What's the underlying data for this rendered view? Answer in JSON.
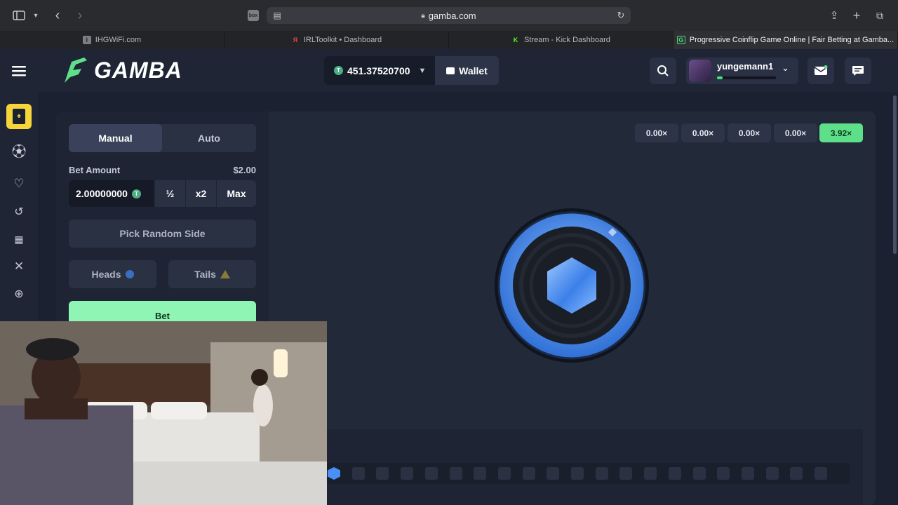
{
  "browser": {
    "url": "gamba.com",
    "tabs": [
      {
        "title": "IHGWiFi.com",
        "favicon": "I",
        "favicon_color": "#7d7e83"
      },
      {
        "title": "IRLToolkit • Dashboard",
        "favicon": "Я",
        "favicon_color": "#e0453a"
      },
      {
        "title": "Stream - Kick Dashboard",
        "favicon": "K",
        "favicon_color": "#53fc18"
      },
      {
        "title": "Progressive Coinflip Game Online | Fair Betting at Gamba...",
        "favicon": "G",
        "favicon_color": "#4ade80",
        "active": true
      }
    ]
  },
  "header": {
    "logo_text": "GAMBA",
    "balance": "451.37520700",
    "balance_token": "T",
    "wallet_label": "Wallet",
    "username": "yungemann1",
    "xp_fraction": 0.1
  },
  "controls": {
    "tab_manual": "Manual",
    "tab_auto": "Auto",
    "bet_amount_label": "Bet Amount",
    "bet_amount_usd": "$2.00",
    "bet_value": "2.00000000",
    "half_label": "½",
    "double_label": "x2",
    "max_label": "Max",
    "random_side_label": "Pick Random Side",
    "heads_label": "Heads",
    "tails_label": "Tails",
    "bet_label": "Bet"
  },
  "multipliers": [
    "0.00×",
    "0.00×",
    "0.00×",
    "0.00×",
    "3.92×"
  ],
  "colors": {
    "accent_green": "#5ee08a",
    "bet_green": "#8ff5b5",
    "coin_blue": "#4a8ff5",
    "tails_gold": "#8a7a3a"
  },
  "history": {
    "squares": 21,
    "active_index": 0
  },
  "rail_icons": [
    "cards-icon",
    "sports-ball-icon",
    "heart-icon",
    "history-icon",
    "building-icon",
    "swords-icon",
    "target-icon"
  ]
}
